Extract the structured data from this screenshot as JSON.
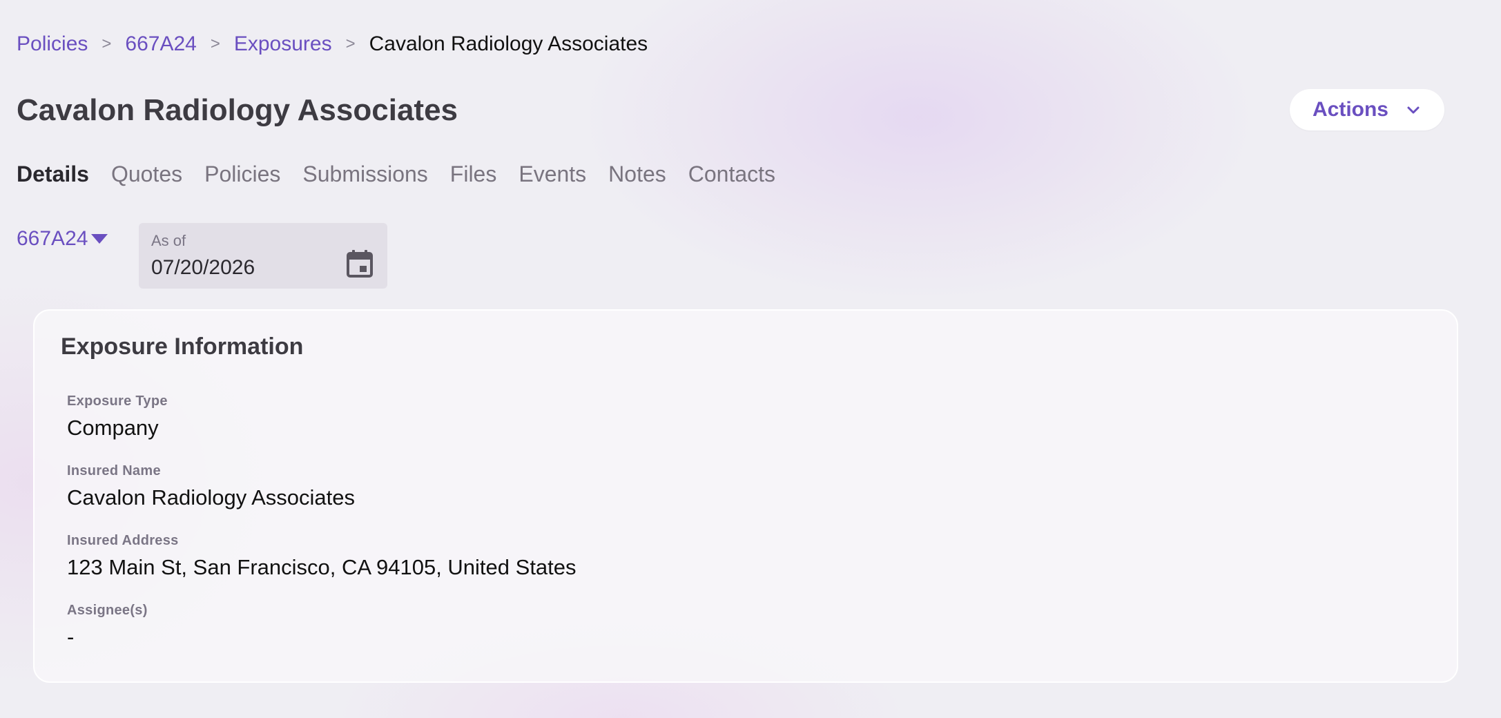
{
  "breadcrumb": {
    "items": [
      {
        "label": "Policies"
      },
      {
        "label": "667A24"
      },
      {
        "label": "Exposures"
      }
    ],
    "current": "Cavalon Radiology Associates",
    "separator": ">"
  },
  "header": {
    "title": "Cavalon Radiology Associates",
    "actions_label": "Actions"
  },
  "tabs": [
    {
      "label": "Details",
      "active": true
    },
    {
      "label": "Quotes",
      "active": false
    },
    {
      "label": "Policies",
      "active": false
    },
    {
      "label": "Submissions",
      "active": false
    },
    {
      "label": "Files",
      "active": false
    },
    {
      "label": "Events",
      "active": false
    },
    {
      "label": "Notes",
      "active": false
    },
    {
      "label": "Contacts",
      "active": false
    }
  ],
  "filters": {
    "policy_selected": "667A24",
    "as_of_label": "As of",
    "as_of_value": "07/20/2026"
  },
  "card": {
    "title": "Exposure Information",
    "fields": [
      {
        "label": "Exposure Type",
        "value": "Company"
      },
      {
        "label": "Insured Name",
        "value": "Cavalon Radiology Associates"
      },
      {
        "label": "Insured Address",
        "value": "123 Main St, San Francisco, CA 94105, United States"
      },
      {
        "label": "Assignee(s)",
        "value": "-"
      }
    ]
  },
  "icons": {
    "breadcrumb_separator": "chevron-right-icon",
    "actions": "chevron-down-icon",
    "policy_dropdown": "caret-down-icon",
    "date_picker": "calendar-icon"
  },
  "colors": {
    "accent": "#6a4fc0",
    "title": "#3d3b42",
    "muted": "#79747f",
    "background": "#efeef3",
    "card": "#f8f7fa"
  }
}
